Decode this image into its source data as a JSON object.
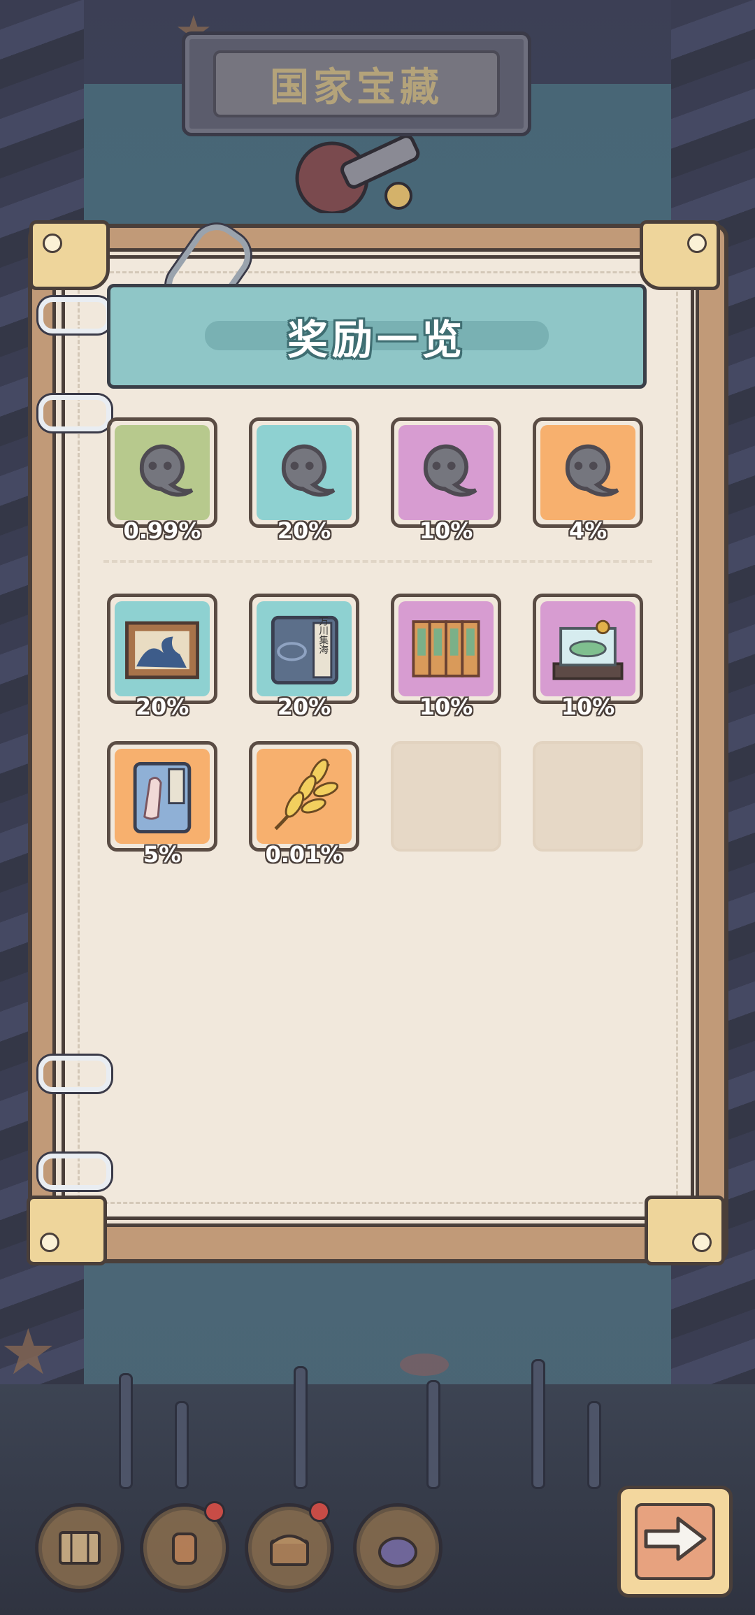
{
  "screen": {
    "title": "国家宝藏"
  },
  "panel": {
    "title": "奖励一览"
  },
  "rewards": [
    {
      "id": "egg-green",
      "icon": "mystery-tadpole-icon",
      "percent": "0.99%",
      "color": "#b7c98d"
    },
    {
      "id": "egg-teal",
      "icon": "mystery-tadpole-icon",
      "percent": "20%",
      "color": "#8ed1d1"
    },
    {
      "id": "egg-purple",
      "icon": "mystery-tadpole-icon",
      "percent": "10%",
      "color": "#d79cd1"
    },
    {
      "id": "egg-orange",
      "icon": "mystery-tadpole-icon",
      "percent": "4%",
      "color": "#f7b06e"
    },
    {
      "id": "wave-painting",
      "icon": "framed-wave-painting-icon",
      "percent": "20%",
      "color": "#8ed1d1"
    },
    {
      "id": "book",
      "icon": "old-book-icon",
      "percent": "20%",
      "color": "#8ed1d1",
      "book_title": "万川集海"
    },
    {
      "id": "folding-screen",
      "icon": "folding-screen-icon",
      "percent": "10%",
      "color": "#d79cd1"
    },
    {
      "id": "jade-display",
      "icon": "jade-display-case-icon",
      "percent": "10%",
      "color": "#d79cd1"
    },
    {
      "id": "scroll-portrait",
      "icon": "portrait-scroll-icon",
      "percent": "5%",
      "color": "#f7b06e"
    },
    {
      "id": "golden-leaf",
      "icon": "golden-wheat-leaf-icon",
      "percent": "0.01%",
      "color": "#f7b06e"
    }
  ],
  "empty_slots": 2,
  "bottom_bar": {
    "buttons": [
      {
        "icon": "map-icon"
      },
      {
        "icon": "lantern-icon",
        "badge": true
      },
      {
        "icon": "treasure-chest-icon",
        "badge": true
      },
      {
        "icon": "pot-icon"
      }
    ],
    "next_icon": "arrow-right-icon"
  },
  "colors": {
    "banner": "#8fc6c7",
    "page": "#f1e8dc",
    "frame": "#c19a78",
    "accent_gold": "#eed59b"
  }
}
